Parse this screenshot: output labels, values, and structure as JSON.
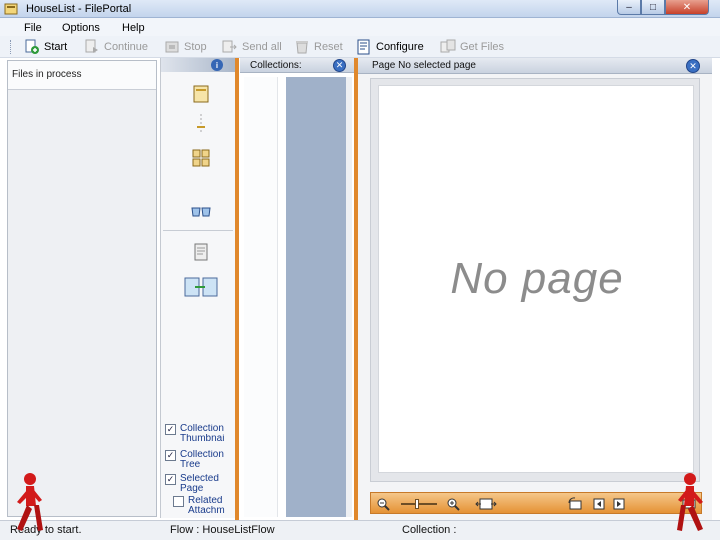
{
  "window": {
    "title": "HouseList - FilePortal",
    "minimize_glyph": "–",
    "maximize_glyph": "□",
    "close_glyph": "✕"
  },
  "menu": [
    "File",
    "Options",
    "Help"
  ],
  "toolbar": {
    "buttons": [
      {
        "label": "Start",
        "icon": "start-icon",
        "enabled": true
      },
      {
        "label": "Continue",
        "icon": "continue-icon",
        "enabled": false
      },
      {
        "label": "Stop",
        "icon": "stop-icon",
        "enabled": false
      },
      {
        "label": "Send all",
        "icon": "send-all-icon",
        "enabled": false
      },
      {
        "label": "Reset",
        "icon": "reset-icon",
        "enabled": false
      },
      {
        "label": "Configure",
        "icon": "configure-icon",
        "enabled": true
      },
      {
        "label": "Get Files",
        "icon": "get-files-icon",
        "enabled": false
      }
    ]
  },
  "left_panel": {
    "title": "Files in process"
  },
  "side_panel": {
    "info_glyph": "i",
    "checkboxes": [
      {
        "label_line1": "Collection",
        "label_line2": "Thumbnail",
        "checked": true
      },
      {
        "label_line1": "Collection",
        "label_line2": "Tree",
        "checked": true
      },
      {
        "label_line1": "Selected",
        "label_line2": "Page",
        "checked": true
      },
      {
        "label_line1": "Related",
        "label_line2": "Attachm",
        "checked": false
      }
    ],
    "check_glyph": "✓"
  },
  "collection_panel": {
    "title": "Collections:",
    "close_glyph": "✕"
  },
  "page_panel": {
    "title": "Page   No selected page",
    "close_glyph": "✕",
    "placeholder": "No page"
  },
  "status": {
    "left": "Ready to start.",
    "flow": "Flow : HouseListFlow",
    "collection": "Collection :"
  },
  "colors": {
    "accent_orange": "#e0882c",
    "collection_view": "#a0b1c9",
    "title_bar": "#c3d4ec",
    "close_red": "#c7412a",
    "walker_red": "#d21a1a"
  }
}
